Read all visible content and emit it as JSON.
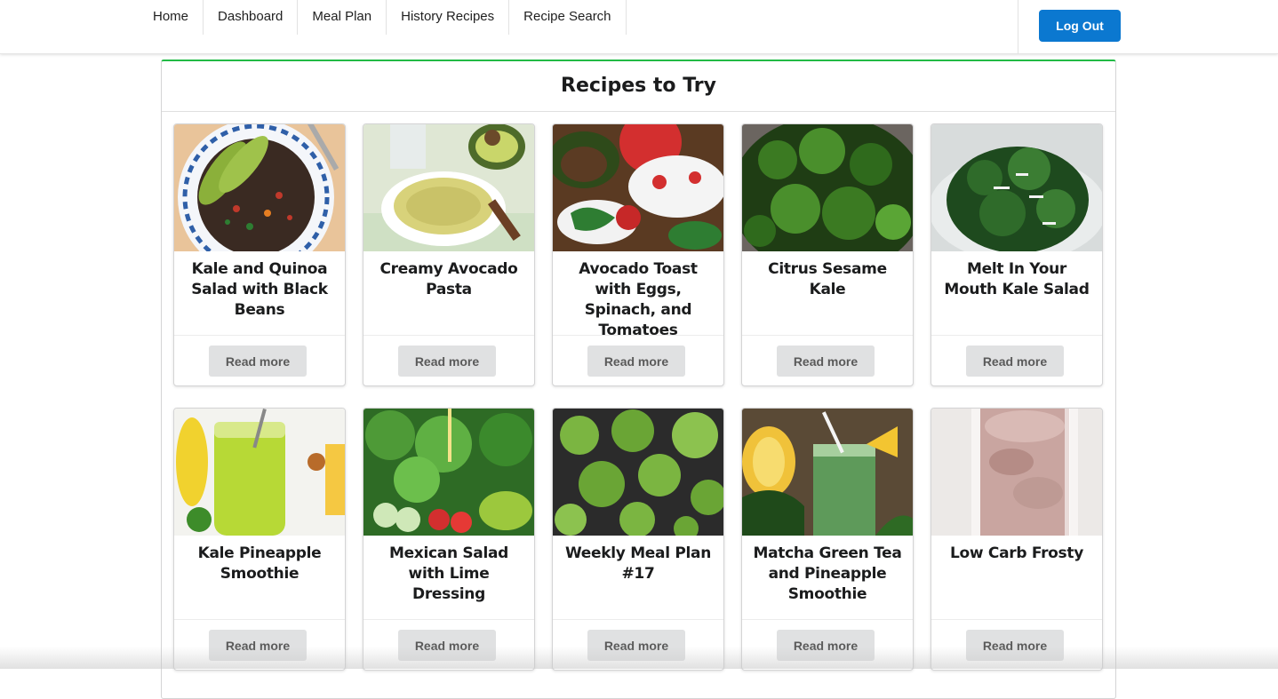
{
  "nav": {
    "items": [
      {
        "label": "Home"
      },
      {
        "label": "Dashboard"
      },
      {
        "label": "Meal Plan"
      },
      {
        "label": "History Recipes"
      },
      {
        "label": "Recipe Search"
      }
    ],
    "logout_label": "Log Out",
    "logout_color": "#0b78d0"
  },
  "panel": {
    "title": "Recipes to Try",
    "accent_color": "#21ba45"
  },
  "recipes": [
    {
      "title": "Kale and Quinoa Salad with Black Beans",
      "button": "Read more",
      "image": "quinoa-salad-photo"
    },
    {
      "title": "Creamy Avocado Pasta",
      "button": "Read more",
      "image": "avocado-pasta-photo"
    },
    {
      "title": "Avocado Toast with Eggs, Spinach, and Tomatoes",
      "button": "Read more",
      "image": "avocado-toast-photo"
    },
    {
      "title": "Citrus Sesame Kale",
      "button": "Read more",
      "image": "sesame-kale-photo"
    },
    {
      "title": "Melt In Your Mouth Kale Salad",
      "button": "Read more",
      "image": "kale-salad-photo"
    },
    {
      "title": "Kale Pineapple Smoothie",
      "button": "Read more",
      "image": "green-smoothie-photo"
    },
    {
      "title": "Mexican Salad with Lime Dressing",
      "button": "Read more",
      "image": "mexican-salad-photo"
    },
    {
      "title": "Weekly Meal Plan #17",
      "button": "Read more",
      "image": "roasted-broccoli-photo"
    },
    {
      "title": "Matcha Green Tea and Pineapple Smoothie",
      "button": "Read more",
      "image": "matcha-smoothie-photo"
    },
    {
      "title": "Low Carb Frosty",
      "button": "Read more",
      "image": "frosty-shake-photo"
    }
  ]
}
